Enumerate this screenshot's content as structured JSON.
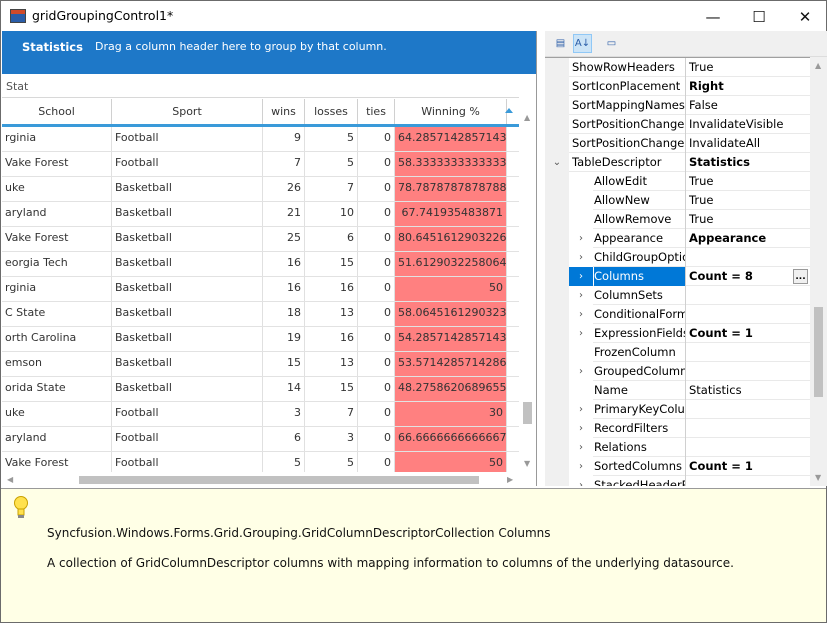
{
  "window": {
    "title": "gridGroupingControl1*",
    "minimize": "—",
    "maximize": "☐",
    "close": "✕"
  },
  "group_panel": {
    "table_name": "Statistics",
    "hint": "Drag a column header here to group by that column."
  },
  "caption": "Stat",
  "columns": [
    "School",
    "Sport",
    "wins",
    "losses",
    "ties",
    "Winning %"
  ],
  "rows": [
    {
      "school": "rginia",
      "sport": "Football",
      "wins": "9",
      "losses": "5",
      "ties": "0",
      "pct": "64.2857142857143"
    },
    {
      "school": "Vake Forest",
      "sport": "Football",
      "wins": "7",
      "losses": "5",
      "ties": "0",
      "pct": "58.3333333333333"
    },
    {
      "school": "uke",
      "sport": "Basketball",
      "wins": "26",
      "losses": "7",
      "ties": "0",
      "pct": "78.7878787878788"
    },
    {
      "school": "aryland",
      "sport": "Basketball",
      "wins": "21",
      "losses": "10",
      "ties": "0",
      "pct": "67.741935483871"
    },
    {
      "school": "Vake Forest",
      "sport": "Basketball",
      "wins": "25",
      "losses": "6",
      "ties": "0",
      "pct": "80.6451612903226"
    },
    {
      "school": "eorgia Tech",
      "sport": "Basketball",
      "wins": "16",
      "losses": "15",
      "ties": "0",
      "pct": "51.6129032258064"
    },
    {
      "school": "rginia",
      "sport": "Basketball",
      "wins": "16",
      "losses": "16",
      "ties": "0",
      "pct": "50"
    },
    {
      "school": "C State",
      "sport": "Basketball",
      "wins": "18",
      "losses": "13",
      "ties": "0",
      "pct": "58.0645161290323"
    },
    {
      "school": "orth Carolina",
      "sport": "Basketball",
      "wins": "19",
      "losses": "16",
      "ties": "0",
      "pct": "54.2857142857143"
    },
    {
      "school": "emson",
      "sport": "Basketball",
      "wins": "15",
      "losses": "13",
      "ties": "0",
      "pct": "53.5714285714286"
    },
    {
      "school": "orida State",
      "sport": "Basketball",
      "wins": "14",
      "losses": "15",
      "ties": "0",
      "pct": "48.2758620689655"
    },
    {
      "school": "uke",
      "sport": "Football",
      "wins": "3",
      "losses": "7",
      "ties": "0",
      "pct": "30"
    },
    {
      "school": "aryland",
      "sport": "Football",
      "wins": "6",
      "losses": "3",
      "ties": "0",
      "pct": "66.6666666666667"
    },
    {
      "school": "Vake Forest",
      "sport": "Football",
      "wins": "5",
      "losses": "5",
      "ties": "0",
      "pct": "50"
    }
  ],
  "properties": [
    {
      "name": "ShowRowHeaders",
      "value": "True",
      "bold": false,
      "level": 0,
      "expander": ""
    },
    {
      "name": "SortIconPlacement",
      "value": "Right",
      "bold": true,
      "level": 0,
      "expander": ""
    },
    {
      "name": "SortMappingNames",
      "value": "False",
      "bold": false,
      "level": 0,
      "expander": ""
    },
    {
      "name": "SortPositionChanged",
      "value": "InvalidateVisible",
      "bold": false,
      "level": 0,
      "expander": ""
    },
    {
      "name": "SortPositionChanged",
      "value": "InvalidateAll",
      "bold": false,
      "level": 0,
      "expander": ""
    },
    {
      "name": "TableDescriptor",
      "value": "Statistics",
      "bold": true,
      "level": 0,
      "expander": "⌄"
    },
    {
      "name": "AllowEdit",
      "value": "True",
      "bold": false,
      "level": 1,
      "expander": ""
    },
    {
      "name": "AllowNew",
      "value": "True",
      "bold": false,
      "level": 1,
      "expander": ""
    },
    {
      "name": "AllowRemove",
      "value": "True",
      "bold": false,
      "level": 1,
      "expander": ""
    },
    {
      "name": "Appearance",
      "value": "Appearance",
      "bold": true,
      "level": 1,
      "expander": "›"
    },
    {
      "name": "ChildGroupOptio",
      "value": "",
      "bold": false,
      "level": 1,
      "expander": "›"
    },
    {
      "name": "Columns",
      "value": "Count = 8",
      "bold": true,
      "level": 1,
      "expander": "›",
      "selected": true
    },
    {
      "name": "ColumnSets",
      "value": "",
      "bold": false,
      "level": 1,
      "expander": "›"
    },
    {
      "name": "ConditionalForm",
      "value": "",
      "bold": false,
      "level": 1,
      "expander": "›"
    },
    {
      "name": "ExpressionFields",
      "value": "Count = 1",
      "bold": true,
      "level": 1,
      "expander": "›"
    },
    {
      "name": "FrozenColumn",
      "value": "",
      "bold": false,
      "level": 1,
      "expander": ""
    },
    {
      "name": "GroupedColumn",
      "value": "",
      "bold": false,
      "level": 1,
      "expander": "›"
    },
    {
      "name": "Name",
      "value": "Statistics",
      "bold": false,
      "level": 1,
      "expander": ""
    },
    {
      "name": "PrimaryKeyColur",
      "value": "",
      "bold": false,
      "level": 1,
      "expander": "›"
    },
    {
      "name": "RecordFilters",
      "value": "",
      "bold": false,
      "level": 1,
      "expander": "›"
    },
    {
      "name": "Relations",
      "value": "",
      "bold": false,
      "level": 1,
      "expander": "›"
    },
    {
      "name": "SortedColumns",
      "value": "Count = 1",
      "bold": true,
      "level": 1,
      "expander": "›"
    },
    {
      "name": "StackedHeaderRc",
      "value": "",
      "bold": false,
      "level": 1,
      "expander": "›"
    }
  ],
  "help": {
    "title": "Syncfusion.Windows.Forms.Grid.Grouping.GridColumnDescriptorCollection Columns",
    "description": "A collection of GridColumnDescriptor columns with mapping information to columns of the underlying datasource."
  },
  "colors": {
    "group_panel": "#1e78c8",
    "winning_pct_cell": "#ff8080",
    "selection": "#0078d7",
    "help_bg": "#ffffe6"
  }
}
